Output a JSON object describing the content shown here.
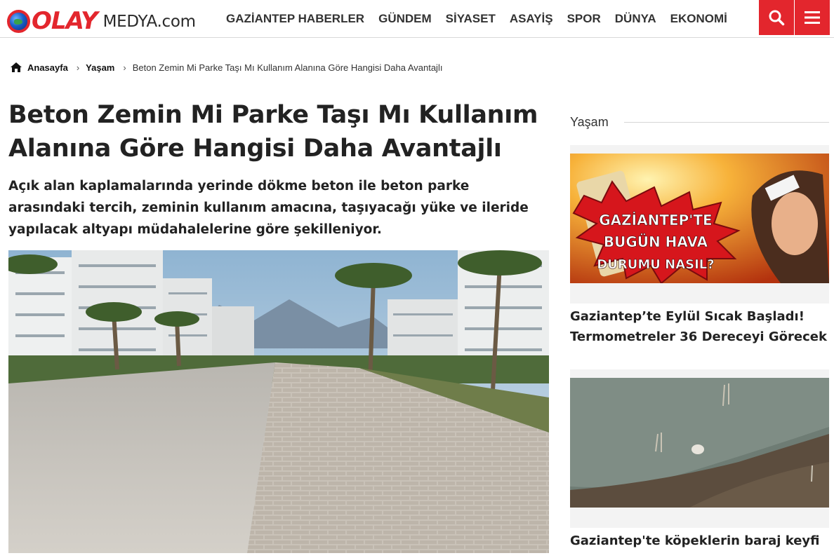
{
  "site": {
    "logo_primary": "OLAY",
    "logo_secondary": "MEDYA.com",
    "brand_color": "#e3262d"
  },
  "nav": {
    "items": [
      {
        "label": "GAZİANTEP HABERLER"
      },
      {
        "label": "GÜNDEM"
      },
      {
        "label": "SİYASET"
      },
      {
        "label": "ASAYİŞ"
      },
      {
        "label": "SPOR"
      },
      {
        "label": "DÜNYA"
      },
      {
        "label": "EKONOMİ"
      }
    ],
    "search_icon": "search-icon",
    "menu_icon": "hamburger-menu-icon"
  },
  "breadcrumb": {
    "home": "Anasayfa",
    "category": "Yaşam",
    "current": "Beton Zemin Mi Parke Taşı Mı Kullanım Alanına Göre Hangisi Daha Avantajlı"
  },
  "article": {
    "title": "Beton Zemin Mi Parke Taşı Mı Kullanım Alanına Göre Hangisi Daha Avantajlı",
    "summary": "Açık alan kaplamalarında yerinde dökme beton ile beton parke arasındaki tercih, zeminin kullanım amacına, taşıyacağı yüke ve ileride yapılacak altyapı müdahalelerine göre şekilleniyor."
  },
  "sidebar": {
    "heading": "Yaşam",
    "cards": [
      {
        "image_text_1": "GAZİANTEP'TE",
        "image_text_2": "BUGÜN HAVA",
        "image_text_3": "DURUMU NASIL?",
        "title": "Gaziantep’te Eylül Sıcak Başladı! Termometreler 36 Dereceyi Görecek"
      },
      {
        "title": "Gaziantep'te köpeklerin baraj keyfi"
      }
    ]
  }
}
